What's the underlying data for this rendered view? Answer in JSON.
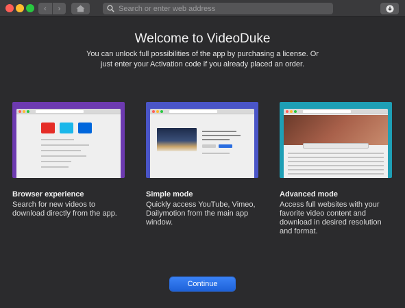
{
  "toolbar": {
    "back_glyph": "‹",
    "forward_glyph": "›",
    "search_placeholder": "Search or enter web address"
  },
  "colors": {
    "accent": "#2a6de0",
    "card_browser": "#6d3ab0",
    "card_simple": "#4a55c7",
    "card_advanced": "#1e9fb5"
  },
  "welcome": {
    "title": "Welcome to VideoDuke",
    "subtitle": "You can unlock full possibilities of the app by purchasing a license. Or just enter your Activation code if you already placed an order."
  },
  "cards": [
    {
      "title": "Browser experience",
      "description": "Search for new videos to download directly from the app."
    },
    {
      "title": "Simple mode",
      "description": "Quickly access YouTube, Vimeo, Dailymotion from the main app window."
    },
    {
      "title": "Advanced mode",
      "description": "Access full websites with your favorite video content and download in desired resolution and format."
    }
  ],
  "continue_label": "Continue"
}
